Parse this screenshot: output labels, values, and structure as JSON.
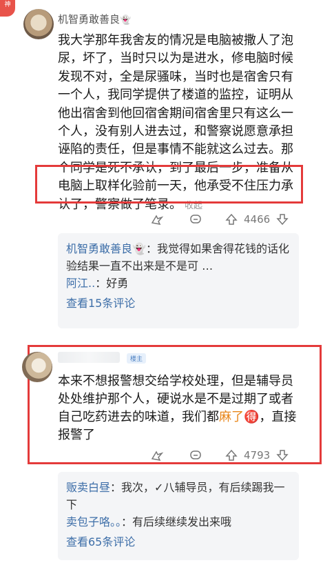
{
  "corner_badge": "神",
  "comment1": {
    "username": "机智勇敢善良",
    "username_emoji": "👻",
    "text": "我大学那年我舍友的情况是电脑被撒人了泡尿，坏了，当时只以为是进水，修电脑时候发现不对，全是尿骚味，当时也是宿舍只有一个人，我同学提供了楼道的监控，证明从他出宿舍到他回宿舍期间宿舍里只有这么一个人，没有别人进去过，和警察说愿意承担诬陷的责任，但是事情不能就这么过去。那个同学是死不承认，到了最后一步，准备从电脑上取样化验前一天，他承受不住压力承认了，警察做了笔录。",
    "collapse_label": "收起",
    "like_count": "4466",
    "replies": [
      {
        "name": "机智勇敢善良",
        "emoji": "👻",
        "sep": "：",
        "text": "我觉得如果舍得花钱的话化验结果一直不出来是不是可 …"
      },
      {
        "name": "阿江..",
        "emoji": "",
        "sep": "：",
        "text": "好勇"
      }
    ],
    "view_more": "查看15条评论"
  },
  "comment2": {
    "op_badge": "楼主",
    "text_before": "本来不想报警想交给学校处理，但是辅导员处处维护那个人，硬说水是不是过期了或者自己吃药进去的味道，我们都",
    "text_highlight": "麻了",
    "text_emoji": "🉐",
    "text_after": "，直接报警了",
    "like_count": "4793",
    "replies": [
      {
        "name": "贩卖白昼",
        "sep": "：",
        "text": "我次，✓八辅导员，有后续踢我一下"
      },
      {
        "name": "卖包子咯。。",
        "sep": "：",
        "text": "有后续继续发出来哦"
      }
    ],
    "view_more": "查看65条评论"
  },
  "colors": {
    "link": "#3d6ea8",
    "highlight_box": "#e43a3a",
    "accent": "#e8861a"
  }
}
